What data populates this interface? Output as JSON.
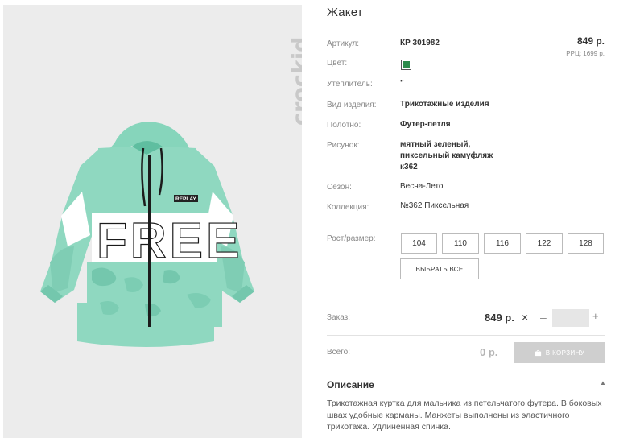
{
  "brand": {
    "logo_text": "crockid"
  },
  "product": {
    "title": "Жакет",
    "price": "849 р.",
    "rrp": "РРЦ: 1699 р.",
    "swatch_color": "#2b8a4a",
    "artwork_text": {
      "badge": "REPLAY",
      "print": "FREE"
    }
  },
  "specs": {
    "article": {
      "label": "Артикул:",
      "value": "КР 301982"
    },
    "color": {
      "label": "Цвет:"
    },
    "insulation": {
      "label": "Утеплитель:",
      "value": "\""
    },
    "type": {
      "label": "Вид изделия:",
      "value": "Трикотажные изделия"
    },
    "fabric": {
      "label": "Полотно:",
      "value": "Футер-петля"
    },
    "pattern": {
      "label": "Рисунок:",
      "line1": "мятный зеленый,",
      "line2": "пиксельный камуфляж",
      "line3": "к362"
    },
    "season": {
      "label": "Сезон:",
      "value": "Весна-Лето"
    },
    "collection": {
      "label": "Коллекция:",
      "value": "№362 Пиксельная"
    }
  },
  "sizes": {
    "label": "Рост/размер:",
    "options": [
      "104",
      "110",
      "116",
      "122",
      "128"
    ],
    "select_all": "ВЫБРАТЬ ВСЕ"
  },
  "order": {
    "label": "Заказ:",
    "price": "849 р.",
    "times": "×",
    "minus": "–",
    "plus": "+",
    "quantity": ""
  },
  "total": {
    "label": "Всего:",
    "value": "0 р.",
    "cart_button": "В КОРЗИНУ"
  },
  "description": {
    "title": "Описание",
    "toggle": "▲",
    "text": "Трикотажная куртка для мальчика из петельчатого футера. В боковых швах удобные карманы. Манжеты выполнены из эластичного трикотажа. Удлиненная спинка."
  }
}
